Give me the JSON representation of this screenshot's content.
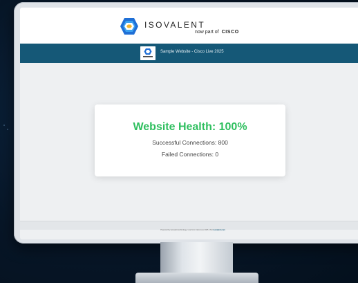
{
  "header": {
    "brand_name": "ISOVALENT",
    "brand_sub_prefix": "now part of",
    "brand_sub_company": "CISCO",
    "logo_icon": "isovalent-hexagon-icon"
  },
  "nav": {
    "title": "Sample Website - Cisco Live 2025"
  },
  "health": {
    "title": "Website Health: 100%",
    "successful": "Successful Connections: 800",
    "failed": "Failed Connections: 0"
  },
  "footer": {
    "text": "Powered by Isovalent technology. Live from Cisco Live 2025. Visit",
    "link": "isovalent.com"
  },
  "colors": {
    "nav_bar": "#155877",
    "health_green": "#2fbf5f",
    "background": "#071627"
  }
}
